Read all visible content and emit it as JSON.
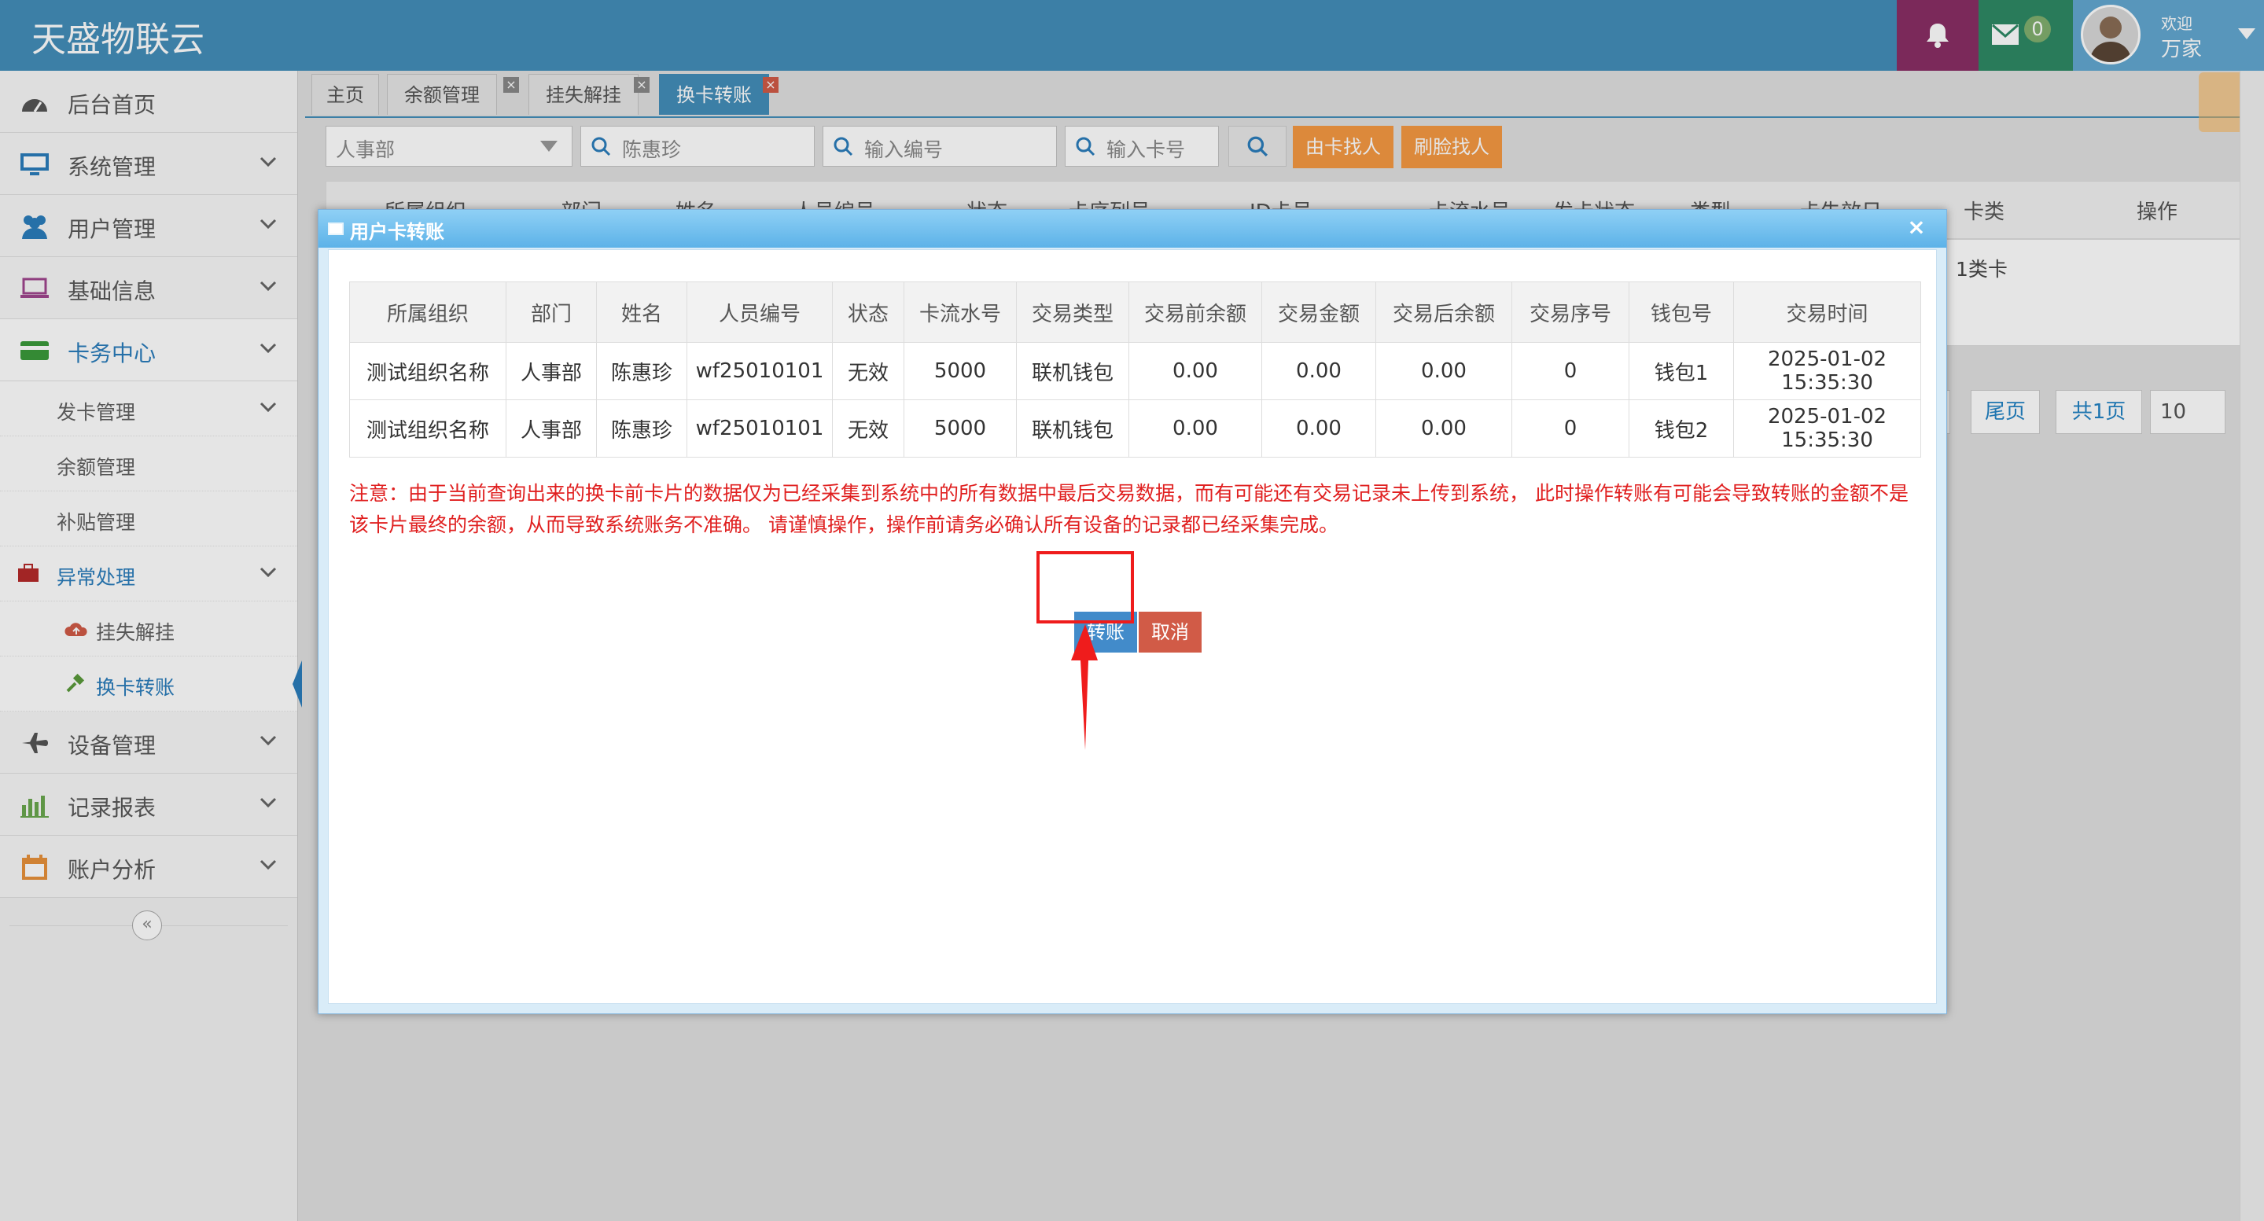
{
  "brand": "天盛物联云",
  "topnav": {
    "mail_count": "0",
    "welcome": "欢迎",
    "user": "万家",
    "colors": {
      "bar": "#438eb9",
      "bell": "#892e65",
      "mail": "#2e8965",
      "user": "#62a8d1"
    }
  },
  "sidebar": {
    "home": "后台首页",
    "system": "系统管理",
    "users": "用户管理",
    "basic": "基础信息",
    "card_center": "卡务中心",
    "card_issue": "发卡管理",
    "balance": "余额管理",
    "subsidy": "补贴管理",
    "exception": "异常处理",
    "loss": "挂失解挂",
    "transfer": "换卡转账",
    "device": "设备管理",
    "reports": "记录报表",
    "account": "账户分析",
    "collapse_glyph": "«"
  },
  "tabs": [
    "主页",
    "余额管理",
    "挂失解挂",
    "换卡转账"
  ],
  "filters": {
    "dept": "人事部",
    "name": "陈惠珍",
    "number_placeholder": "输入编号",
    "card_placeholder": "输入卡号",
    "find_by_card": "由卡找人",
    "find_by_face": "刷脸找人"
  },
  "bg_table": {
    "headers": [
      "所属组织",
      "部门",
      "姓名",
      "人员编号",
      "状态",
      "卡序列号",
      "ID卡号",
      "卡流水号",
      "发卡状态",
      "类型",
      "卡失效日",
      "卡类",
      "操作"
    ],
    "card_type": "1类卡"
  },
  "pager": {
    "last": "尾页",
    "first_partial": "页",
    "total": "共1页",
    "size": "10"
  },
  "modal": {
    "title": "用户卡转账",
    "close": "×",
    "headers": [
      "所属组织",
      "部门",
      "姓名",
      "人员编号",
      "状态",
      "卡流水号",
      "交易类型",
      "交易前余额",
      "交易金额",
      "交易后余额",
      "交易序号",
      "钱包号",
      "交易时间"
    ],
    "rows": [
      [
        "测试组织名称",
        "人事部",
        "陈惠珍",
        "wf25010101",
        "无效",
        "5000",
        "联机钱包",
        "0.00",
        "0.00",
        "0.00",
        "0",
        "钱包1",
        "2025-01-02 15:35:30"
      ],
      [
        "测试组织名称",
        "人事部",
        "陈惠珍",
        "wf25010101",
        "无效",
        "5000",
        "联机钱包",
        "0.00",
        "0.00",
        "0.00",
        "0",
        "钱包2",
        "2025-01-02 15:35:30"
      ]
    ],
    "notice": "注意：由于当前查询出来的换卡前卡片的数据仅为已经采集到系统中的所有数据中最后交易数据，而有可能还有交易记录未上传到系统， 此时操作转账有可能会导致转账的金额不是该卡片最终的余额，从而导致系统账务不准确。 请谨慎操作，操作前请务必确认所有设备的记录都已经采集完成。",
    "transfer_btn": "转账",
    "cancel_btn": "取消"
  }
}
